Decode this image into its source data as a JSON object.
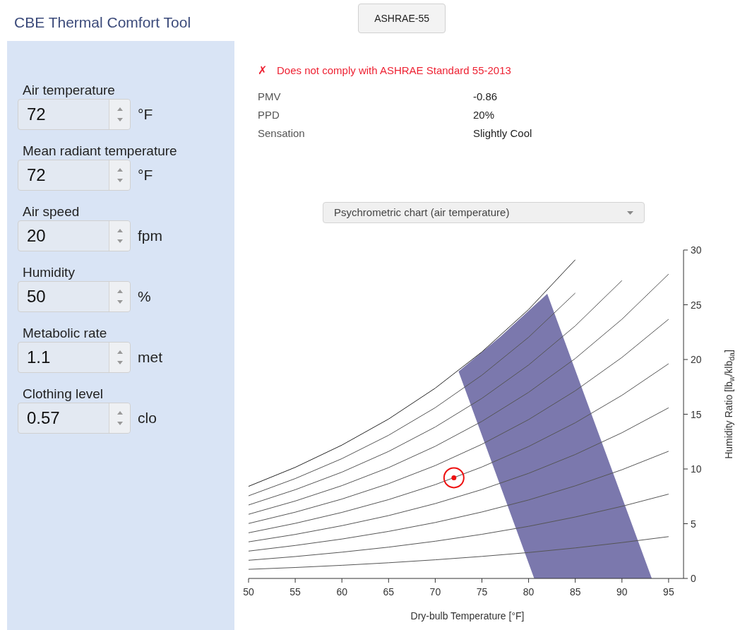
{
  "header": {
    "title": "CBE Thermal Comfort Tool",
    "standard_button": "ASHRAE-55"
  },
  "inputs": [
    {
      "label": "Air temperature",
      "value": "72",
      "unit": "°F"
    },
    {
      "label": "Mean radiant temperature",
      "value": "72",
      "unit": "°F"
    },
    {
      "label": "Air speed",
      "value": "20",
      "unit": "fpm"
    },
    {
      "label": "Humidity",
      "value": "50",
      "unit": "%"
    },
    {
      "label": "Metabolic rate",
      "value": "1.1",
      "unit": "met"
    },
    {
      "label": "Clothing level",
      "value": "0.57",
      "unit": "clo"
    }
  ],
  "compliance": {
    "complies": false,
    "icon": "✗",
    "text": "Does not comply with ASHRAE Standard 55-2013"
  },
  "results": [
    {
      "label": "PMV",
      "value": "-0.86"
    },
    {
      "label": "PPD",
      "value": "20%"
    },
    {
      "label": "Sensation",
      "value": "Slightly Cool"
    }
  ],
  "chart_selector": {
    "value": "Psychrometric chart (air temperature)"
  },
  "chart": {
    "chart_data": {
      "type": "line",
      "xlabel": "Dry-bulb Temperature [°F]",
      "ylabel": "Humidity Ratio [lb$_{w}$/klb$_{da}$]",
      "x": [
        50,
        55,
        60,
        65,
        70,
        75,
        80,
        85,
        90,
        95
      ],
      "xlim": [
        50,
        96.6
      ],
      "ylim": [
        0,
        30
      ],
      "xticks": [
        50,
        55,
        60,
        65,
        70,
        75,
        80,
        85,
        90,
        95
      ],
      "yticks": [
        0,
        5,
        10,
        15,
        20,
        25,
        30
      ],
      "series": [
        {
          "color": "#555555",
          "values": [
            0.83,
            1.0,
            1.2,
            1.43,
            1.7,
            2.01,
            2.37,
            2.79,
            3.28,
            3.82
          ]
        },
        {
          "color": "#555555",
          "values": [
            1.66,
            2.0,
            2.4,
            2.86,
            3.4,
            4.03,
            4.76,
            5.61,
            6.59,
            7.7
          ]
        },
        {
          "color": "#555555",
          "values": [
            2.5,
            3.01,
            3.6,
            4.3,
            5.11,
            6.07,
            7.17,
            8.46,
            9.93,
            11.62
          ]
        },
        {
          "color": "#555555",
          "values": [
            3.34,
            4.02,
            4.82,
            5.74,
            6.84,
            8.12,
            9.6,
            11.32,
            13.31,
            15.59
          ]
        },
        {
          "color": "#555555",
          "values": [
            4.17,
            5.03,
            6.03,
            7.2,
            8.57,
            10.18,
            12.05,
            14.22,
            16.73,
            19.61
          ]
        },
        {
          "color": "#555555",
          "values": [
            5.02,
            6.05,
            7.25,
            8.66,
            10.31,
            12.26,
            14.51,
            17.14,
            20.19,
            23.68
          ]
        },
        {
          "color": "#555555",
          "values": [
            5.86,
            7.07,
            8.48,
            10.12,
            12.07,
            14.35,
            17.0,
            20.09,
            23.68,
            27.8
          ]
        },
        {
          "color": "#555555",
          "values": [
            6.71,
            8.1,
            9.71,
            11.6,
            13.83,
            16.45,
            19.5,
            23.07,
            27.21,
            null
          ]
        },
        {
          "color": "#555555",
          "values": [
            7.55,
            9.12,
            10.94,
            13.08,
            15.6,
            18.57,
            22.03,
            26.07,
            null,
            null
          ]
        },
        {
          "color": "#222222",
          "values": [
            8.41,
            10.15,
            12.18,
            14.56,
            17.38,
            20.7,
            24.57,
            29.11,
            null,
            null
          ]
        }
      ]
    }
  }
}
